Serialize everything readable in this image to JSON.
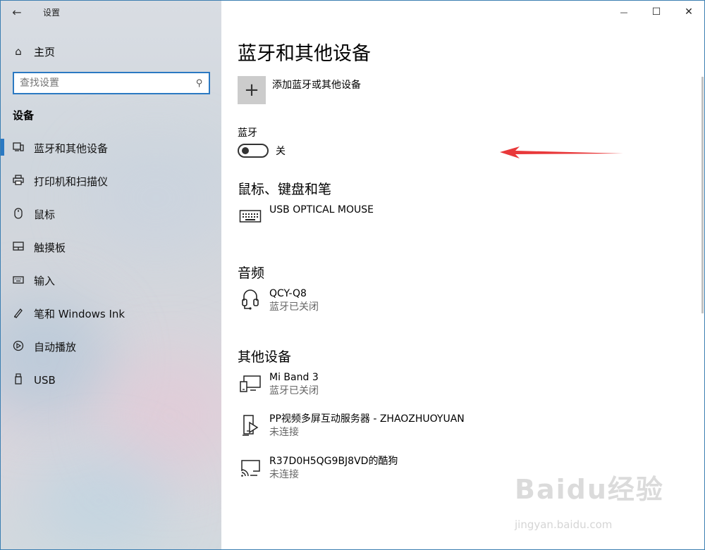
{
  "window": {
    "app_title": "设置",
    "controls": {
      "minimize": "—",
      "maximize": "☐",
      "close": "✕"
    }
  },
  "sidebar": {
    "home_label": "主页",
    "search_placeholder": "查找设置",
    "section_header": "设备",
    "items": [
      {
        "label": "蓝牙和其他设备",
        "icon": "bluetooth-devices-icon",
        "active": true
      },
      {
        "label": "打印机和扫描仪",
        "icon": "printer-icon",
        "active": false
      },
      {
        "label": "鼠标",
        "icon": "mouse-icon",
        "active": false
      },
      {
        "label": "触摸板",
        "icon": "touchpad-icon",
        "active": false
      },
      {
        "label": "输入",
        "icon": "keyboard-icon",
        "active": false
      },
      {
        "label": "笔和 Windows Ink",
        "icon": "pen-icon",
        "active": false
      },
      {
        "label": "自动播放",
        "icon": "autoplay-icon",
        "active": false
      },
      {
        "label": "USB",
        "icon": "usb-icon",
        "active": false
      }
    ],
    "accent_color": "#2b79c2"
  },
  "main": {
    "page_title": "蓝牙和其他设备",
    "add_device_label": "添加蓝牙或其他设备",
    "bluetooth": {
      "label": "蓝牙",
      "state_text": "关",
      "on": false
    },
    "sections": {
      "mouse_keyboard_pen": {
        "title": "鼠标、键盘和笔",
        "devices": [
          {
            "name": "USB OPTICAL MOUSE",
            "status": "",
            "icon": "keyboard-icon"
          }
        ]
      },
      "audio": {
        "title": "音频",
        "devices": [
          {
            "name": "QCY-Q8",
            "status": "蓝牙已关闭",
            "icon": "headset-icon"
          }
        ]
      },
      "other": {
        "title": "其他设备",
        "devices": [
          {
            "name": "Mi Band 3",
            "status": "蓝牙已关闭",
            "icon": "device-icon"
          },
          {
            "name": "PP视频多屏互动服务器 - ZHAOZHUOYUAN",
            "status": "未连接",
            "icon": "media-device-icon"
          },
          {
            "name": "R37D0H5QG9BJ8VD的酷狗",
            "status": "未连接",
            "icon": "wireless-display-icon"
          }
        ]
      }
    }
  },
  "watermark": {
    "logo": "Baidu经验",
    "url": "jingyan.baidu.com"
  }
}
